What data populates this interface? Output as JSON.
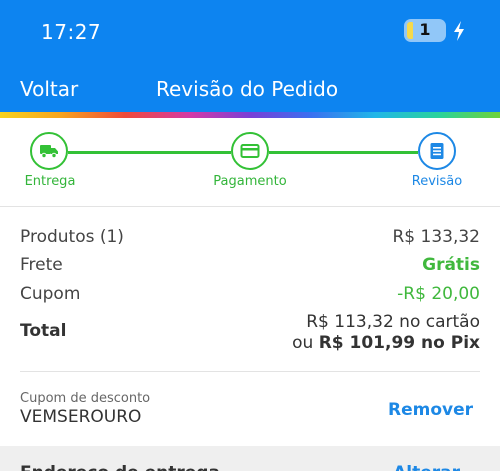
{
  "status_bar": {
    "time": "17:27",
    "battery_level": "1"
  },
  "nav": {
    "back_label": "Voltar",
    "title": "Revisão do Pedido"
  },
  "stepper": {
    "steps": [
      {
        "label": "Entrega",
        "icon": "truck-icon",
        "state": "done"
      },
      {
        "label": "Pagamento",
        "icon": "credit-card-icon",
        "state": "done"
      },
      {
        "label": "Revisão",
        "icon": "document-icon",
        "state": "current"
      }
    ]
  },
  "summary": {
    "products_label": "Produtos (1)",
    "products_value": "R$ 133,32",
    "shipping_label": "Frete",
    "shipping_value": "Grátis",
    "coupon_label": "Cupom",
    "coupon_value": "-R$ 20,00",
    "total_label": "Total",
    "total_card": "R$ 113,32 no cartão",
    "total_pix_prefix": "ou",
    "total_pix": "R$ 101,99 no Pix"
  },
  "coupon": {
    "caption": "Cupom de desconto",
    "code": "VEMSEROURO",
    "remove_label": "Remover"
  },
  "bottom": {
    "left_label": "Endereço de entrega",
    "right_label": "Alterar"
  },
  "colors": {
    "header": "#0d84f0",
    "success": "#33c136",
    "accent": "#1d88e5"
  }
}
